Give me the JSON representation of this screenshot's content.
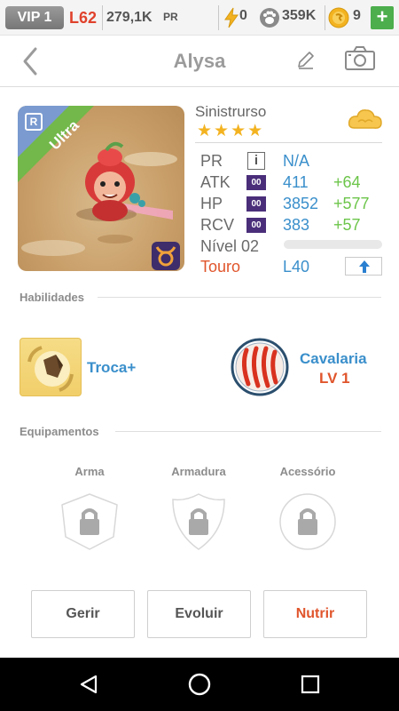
{
  "status_bar": {
    "vip": "VIP 1",
    "level": "L62",
    "power": "279,1K",
    "power_tag": "PR",
    "energy": "0",
    "paw": "359K",
    "coins": "9",
    "plus": "+"
  },
  "header": {
    "title": "Alysa"
  },
  "monster": {
    "rarity_badge": "R",
    "rarity": "Ultra",
    "name": "Sinistrurso",
    "stars": "★★★★",
    "star_count": 4
  },
  "stats": {
    "pr_label": "PR",
    "pr_value": "N/A",
    "info_glyph": "i",
    "atk_label": "ATK",
    "atk_value": "411",
    "atk_bonus": "+64",
    "hp_label": "HP",
    "hp_value": "3852",
    "hp_bonus": "+577",
    "rcv_label": "RCV",
    "rcv_value": "383",
    "rcv_bonus": "+57",
    "plus_badge": "00",
    "level_label": "Nível 02",
    "level_progress": 0,
    "element": "Touro",
    "max_level": "L40"
  },
  "abilities": {
    "section_label": "Habilidades",
    "skill_name": "Troca+",
    "leader_name": "Cavalaria",
    "leader_level": "LV 1"
  },
  "equipment": {
    "section_label": "Equipamentos",
    "weapon": "Arma",
    "armor": "Armadura",
    "accessory": "Acessório"
  },
  "buttons": {
    "manage": "Gerir",
    "evolve": "Evoluir",
    "feed": "Nutrir"
  },
  "colors": {
    "accent_blue": "#3a8fcb",
    "bonus_green": "#6cc54a",
    "accent_orange": "#e0552c",
    "ultra_green": "#72b84a",
    "star_gold": "#f3b321"
  }
}
